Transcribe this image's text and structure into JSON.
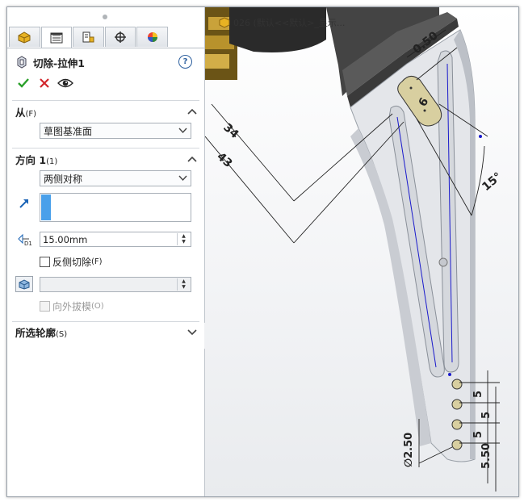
{
  "feature": {
    "title": "切除-拉伸1",
    "help": "?"
  },
  "tabs": [
    "featuremanager-tab",
    "propertymanager-tab",
    "configuration-tab",
    "dimxpert-tab",
    "appearance-tab"
  ],
  "from": {
    "label": "从",
    "key": "(F)",
    "value": "草图基准面"
  },
  "direction": {
    "label": "方向 1",
    "key": "(1)",
    "end_condition": "两侧对称",
    "depth": "15.00mm",
    "flip_side_label": "反侧切除",
    "flip_side_key": "(F)",
    "draft_label": "向外拔模",
    "draft_key": "(O)",
    "draft_value": ""
  },
  "selected_contours": {
    "label": "所选轮廓",
    "key": "(S)"
  },
  "breadcrumb": {
    "text": "026  (默认<<默认>_显示..."
  },
  "dimensions": [
    "0.50",
    "6",
    "34",
    "43",
    "15°",
    "5",
    "5",
    "5",
    "∅2.50",
    "5.50"
  ],
  "colors": {
    "accept": "#2aa02a",
    "cancel": "#d2262c",
    "part_face": "#e4e6ea",
    "sketch_slot": "#d8cfa0",
    "sketch_line": "#1a1acc"
  }
}
